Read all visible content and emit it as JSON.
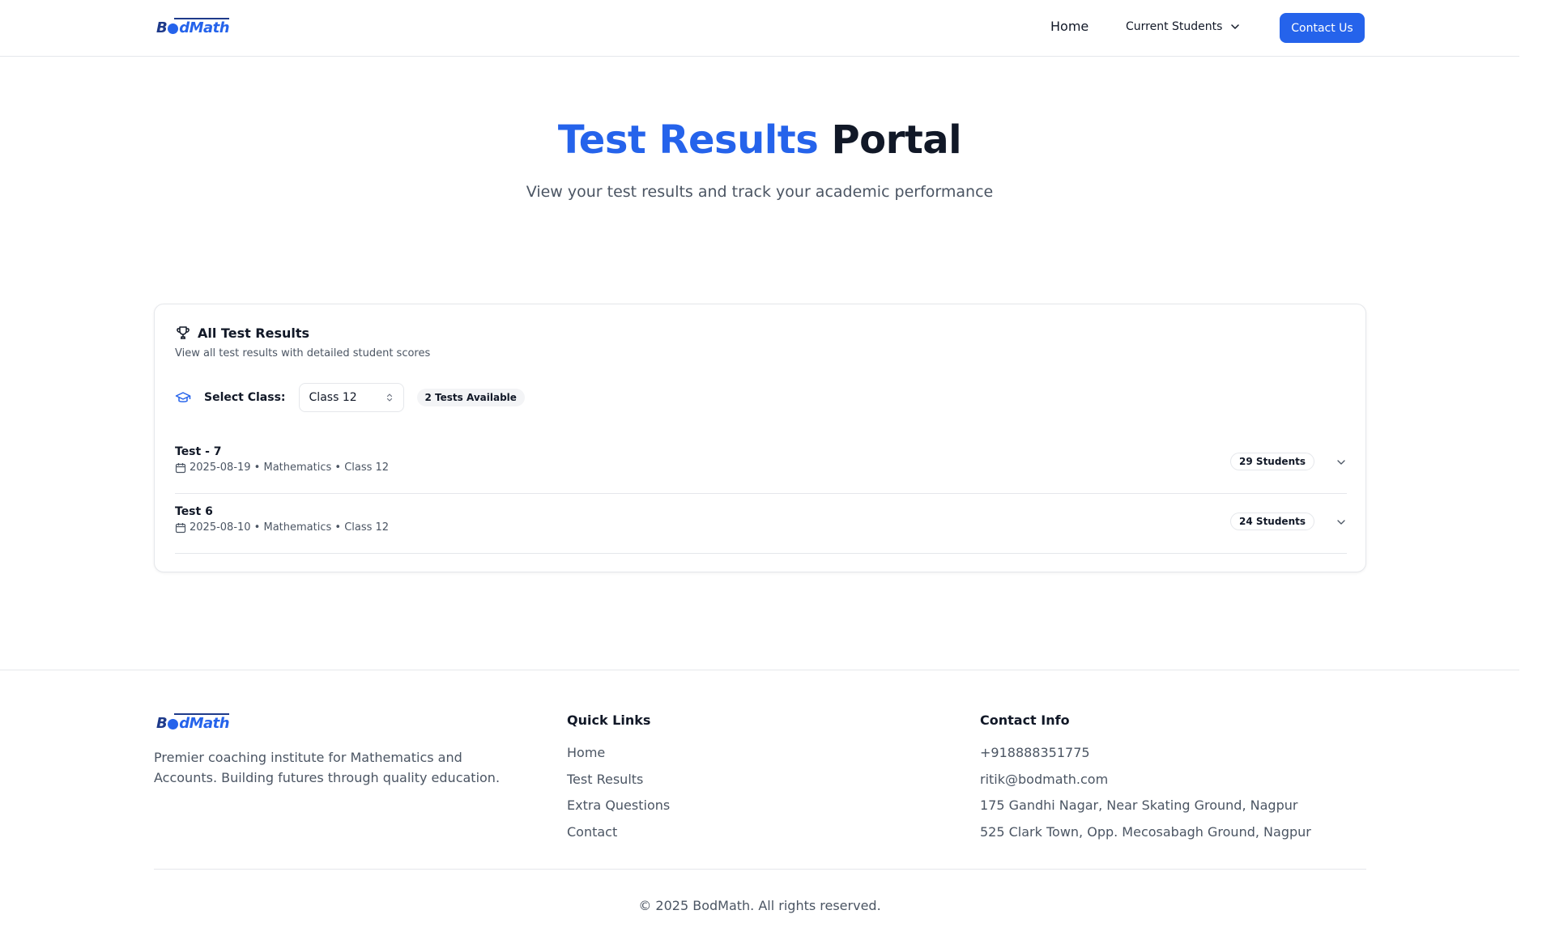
{
  "header": {
    "logo_text": "BodMath",
    "nav": {
      "home": "Home",
      "current_students": "Current Students",
      "contact_button": "Contact Us"
    }
  },
  "hero": {
    "title_accent": "Test Results",
    "title_rest": "Portal",
    "subtitle": "View your test results and track your academic performance"
  },
  "results_card": {
    "title": "All Test Results",
    "description": "View all test results with detailed student scores",
    "class_label": "Select Class:",
    "selected_class": "Class 12",
    "tests_badge": "2 Tests Available",
    "tests": [
      {
        "name": "Test - 7",
        "meta": "2025-08-19 • Mathematics • Class 12",
        "students": "29 Students"
      },
      {
        "name": "Test 6",
        "meta": "2025-08-10 • Mathematics • Class 12",
        "students": "24 Students"
      }
    ]
  },
  "footer": {
    "logo_text": "BodMath",
    "about": "Premier coaching institute for Mathematics and Accounts. Building futures through quality education.",
    "quick_links_title": "Quick Links",
    "quick_links": [
      "Home",
      "Test Results",
      "Extra Questions",
      "Contact"
    ],
    "contact_title": "Contact Info",
    "contact": {
      "phone": "+918888351775",
      "email": "ritik@bodmath.com",
      "address1": "175 Gandhi Nagar, Near Skating Ground, Nagpur",
      "address2": "525 Clark Town, Opp. Mecosabagh Ground, Nagpur"
    },
    "copyright": "© 2025 BodMath. All rights reserved."
  },
  "colors": {
    "accent": "#2563eb",
    "text": "#111827",
    "muted": "#4b5563",
    "border": "#e5e7eb"
  }
}
